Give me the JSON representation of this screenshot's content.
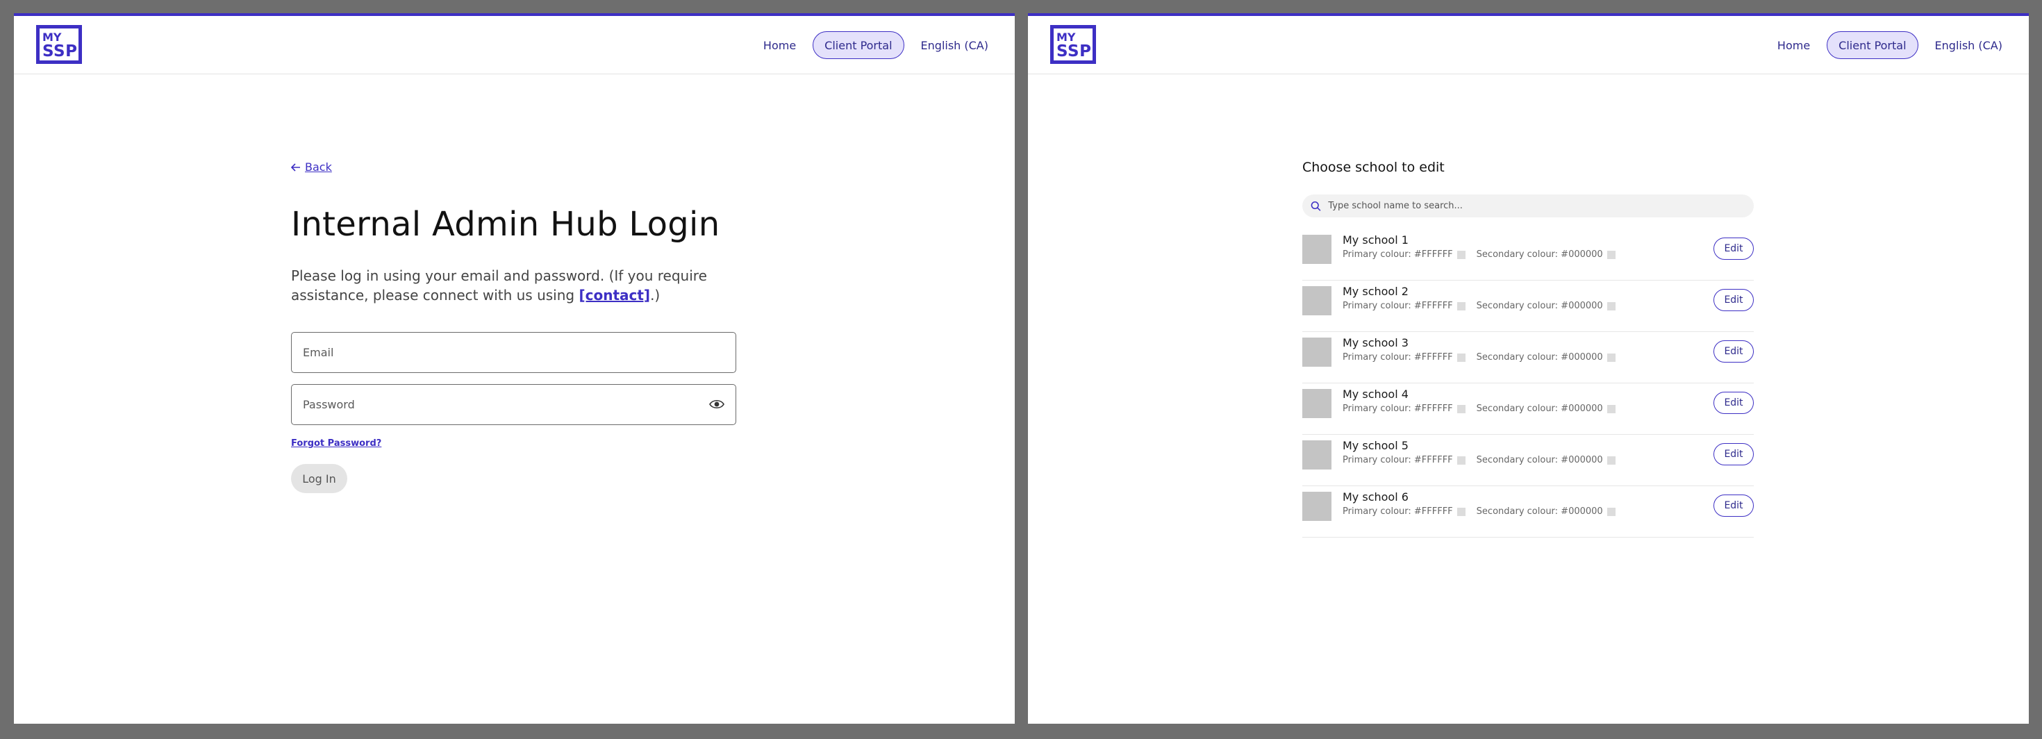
{
  "brand": {
    "logo_line1": "MY",
    "logo_line2": "SSP",
    "accent": "#3d2fc4"
  },
  "nav": {
    "home": "Home",
    "client_portal": "Client Portal",
    "language": "English (CA)"
  },
  "login": {
    "back": "Back",
    "title": "Internal Admin Hub Login",
    "desc_before": "Please log in using your email and password. (If you require assistance, please connect with us using ",
    "desc_link": "[contact]",
    "desc_after": ".)",
    "email_placeholder": "Email",
    "password_placeholder": "Password",
    "forgot": "Forgot Password?",
    "submit": "Log In"
  },
  "chooser": {
    "title": "Choose school to edit",
    "search_placeholder": "Type school name to search...",
    "edit_label": "Edit",
    "schools": [
      {
        "name": "My school 1",
        "primary": "Primary colour: #FFFFFF",
        "secondary": "Secondary colour: #000000"
      },
      {
        "name": "My school 2",
        "primary": "Primary colour: #FFFFFF",
        "secondary": "Secondary colour: #000000"
      },
      {
        "name": "My school 3",
        "primary": "Primary colour: #FFFFFF",
        "secondary": "Secondary colour: #000000"
      },
      {
        "name": "My school 4",
        "primary": "Primary colour: #FFFFFF",
        "secondary": "Secondary colour: #000000"
      },
      {
        "name": "My school 5",
        "primary": "Primary colour: #FFFFFF",
        "secondary": "Secondary colour: #000000"
      },
      {
        "name": "My school 6",
        "primary": "Primary colour: #FFFFFF",
        "secondary": "Secondary colour: #000000"
      }
    ]
  }
}
